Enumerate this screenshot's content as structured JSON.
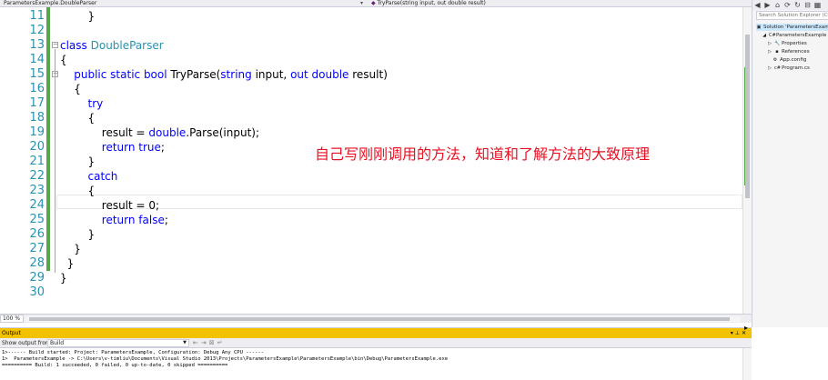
{
  "navbar": {
    "class_path": "ParametersExample.DoubleParser",
    "method_signature": "TryParse(string input, out double result)"
  },
  "editor": {
    "lines": [
      {
        "n": "11",
        "tokens": [
          {
            "t": "        }",
            "c": ""
          }
        ]
      },
      {
        "n": "12",
        "tokens": []
      },
      {
        "n": "13",
        "tokens": [
          {
            "t": "class ",
            "c": "kw"
          },
          {
            "t": "DoubleParser",
            "c": "ty"
          }
        ]
      },
      {
        "n": "14",
        "tokens": [
          {
            "t": "{",
            "c": ""
          }
        ]
      },
      {
        "n": "15",
        "tokens": [
          {
            "t": "    public static bool ",
            "c": "kw"
          },
          {
            "t": "TryParse(",
            "c": ""
          },
          {
            "t": "string ",
            "c": "kw"
          },
          {
            "t": "input, ",
            "c": ""
          },
          {
            "t": "out double ",
            "c": "kw"
          },
          {
            "t": "result)",
            "c": ""
          }
        ]
      },
      {
        "n": "16",
        "tokens": [
          {
            "t": "    {",
            "c": ""
          }
        ]
      },
      {
        "n": "17",
        "tokens": [
          {
            "t": "        try",
            "c": "kw"
          }
        ]
      },
      {
        "n": "18",
        "tokens": [
          {
            "t": "        {",
            "c": ""
          }
        ]
      },
      {
        "n": "19",
        "tokens": [
          {
            "t": "            result = ",
            "c": ""
          },
          {
            "t": "double",
            "c": "kw"
          },
          {
            "t": ".Parse(input);",
            "c": ""
          }
        ]
      },
      {
        "n": "20",
        "tokens": [
          {
            "t": "            return true",
            "c": "kw"
          },
          {
            "t": ";",
            "c": ""
          }
        ]
      },
      {
        "n": "21",
        "tokens": [
          {
            "t": "        }",
            "c": ""
          }
        ]
      },
      {
        "n": "22",
        "tokens": [
          {
            "t": "        catch",
            "c": "kw"
          }
        ]
      },
      {
        "n": "23",
        "tokens": [
          {
            "t": "        {",
            "c": ""
          }
        ]
      },
      {
        "n": "24",
        "tokens": [
          {
            "t": "            result = 0;",
            "c": ""
          }
        ]
      },
      {
        "n": "25",
        "tokens": [
          {
            "t": "            return false",
            "c": "kw"
          },
          {
            "t": ";",
            "c": ""
          }
        ]
      },
      {
        "n": "26",
        "tokens": [
          {
            "t": "        }",
            "c": ""
          }
        ]
      },
      {
        "n": "27",
        "tokens": [
          {
            "t": "    }",
            "c": ""
          }
        ]
      },
      {
        "n": "28",
        "tokens": [
          {
            "t": "  }",
            "c": ""
          }
        ]
      },
      {
        "n": "29",
        "tokens": [
          {
            "t": "}",
            "c": ""
          }
        ]
      },
      {
        "n": "30",
        "tokens": []
      }
    ],
    "annotation": "自己写刚刚调用的方法，知道和了解方法的大致原理",
    "colors": {
      "keyword": "#0000ff",
      "type": "#2b91af",
      "line_number": "#2b91af",
      "annotation": "#e81123",
      "change_bar": "#57a64a"
    }
  },
  "zoom": {
    "level": "100 %"
  },
  "solution_explorer": {
    "search_placeholder": "Search Solution Explorer (Ctrl+;)",
    "items": [
      {
        "label": "Solution 'ParametersExample'",
        "icon": "solution-icon"
      },
      {
        "label": "ParametersExample",
        "icon": "csharp-project-icon"
      },
      {
        "label": "Properties",
        "icon": "wrench-icon"
      },
      {
        "label": "References",
        "icon": "references-icon"
      },
      {
        "label": "App.config",
        "icon": "config-icon"
      },
      {
        "label": "Program.cs",
        "icon": "csharp-file-icon"
      }
    ]
  },
  "output": {
    "title": "Output",
    "show_output_from_label": "Show output from:",
    "source": "Build",
    "lines": [
      "1>------ Build started: Project: ParametersExample, Configuration: Debug Any CPU ------",
      "1>  ParametersExample -> C:\\Users\\v-timliu\\Documents\\Visual Studio 2013\\Projects\\ParametersExample\\ParametersExample\\bin\\Debug\\ParametersExample.exe",
      "========== Build: 1 succeeded, 0 failed, 0 up-to-date, 0 skipped =========="
    ]
  }
}
